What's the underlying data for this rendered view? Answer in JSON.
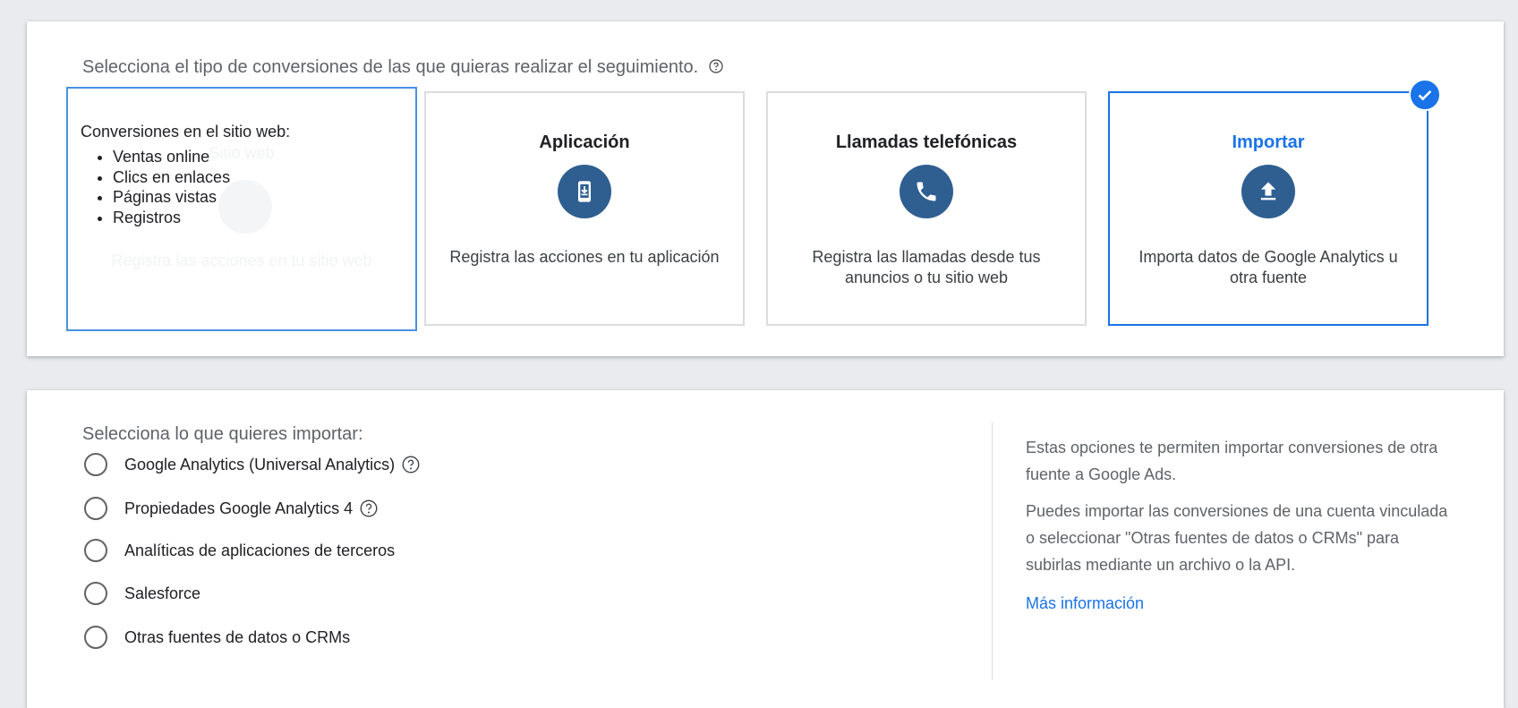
{
  "conversion_types": {
    "heading": "Selecciona el tipo de conversiones de las que quieras realizar el seguimiento.",
    "help_icon": "help-circle-icon",
    "tiles": [
      {
        "id": "website",
        "title": "Sitio web",
        "description": "Registra las acciones en tu sitio web",
        "icon": "cursor-click-icon",
        "state": "focused",
        "tooltip": {
          "heading": "Conversiones en el sitio web:",
          "items": [
            "Ventas online",
            "Clics en enlaces",
            "Páginas vistas",
            "Registros"
          ]
        }
      },
      {
        "id": "app",
        "title": "Aplicación",
        "description": "Registra las acciones en tu aplicación",
        "icon": "phone-download-icon",
        "state": "default"
      },
      {
        "id": "calls",
        "title": "Llamadas telefónicas",
        "description": "Registra las llamadas desde tus anuncios o tu sitio web",
        "icon": "phone-icon",
        "state": "default"
      },
      {
        "id": "import",
        "title": "Importar",
        "description": "Importa datos de Google Analytics u otra fuente",
        "icon": "upload-icon",
        "state": "selected"
      }
    ]
  },
  "import_section": {
    "heading": "Selecciona lo que quieres importar:",
    "options": [
      {
        "label": "Google Analytics (Universal Analytics)",
        "has_help": true,
        "selected": false
      },
      {
        "label": "Propiedades Google Analytics 4",
        "has_help": true,
        "selected": false
      },
      {
        "label": "Analíticas de aplicaciones de terceros",
        "has_help": false,
        "selected": false
      },
      {
        "label": "Salesforce",
        "has_help": false,
        "selected": false
      },
      {
        "label": "Otras fuentes de datos o CRMs",
        "has_help": false,
        "selected": false
      }
    ],
    "info_paragraph_1": "Estas opciones te permiten importar conversiones de otra fuente a Google Ads.",
    "info_paragraph_2": "Puedes importar las conversiones de una cuenta vinculada o seleccionar \"Otras fuentes de datos o CRMs\" para subirlas mediante un archivo o la API.",
    "learn_more": "Más información"
  },
  "colors": {
    "accent": "#1a73e8",
    "icon_circle": "#2f5f91",
    "text_secondary": "#5f6368"
  }
}
